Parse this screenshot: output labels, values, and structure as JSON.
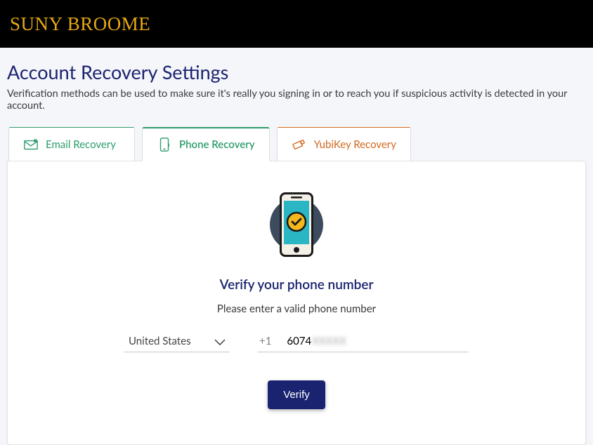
{
  "brand": {
    "name": "SUNY BROOME"
  },
  "page": {
    "title": "Account Recovery Settings",
    "subtitle": "Verification methods can be used to make sure it's really you signing in or to reach you if suspicious activity is detected in your account."
  },
  "tabs": {
    "email": {
      "label": "Email Recovery"
    },
    "phone": {
      "label": "Phone Recovery"
    },
    "yubikey": {
      "label": "YubiKey Recovery"
    }
  },
  "verify": {
    "title": "Verify your phone number",
    "subtitle": "Please enter a valid phone number",
    "country": "United States",
    "prefix": "+1",
    "phone_visible": "6074",
    "phone_hidden": "XXXXX",
    "button": "Verify"
  }
}
